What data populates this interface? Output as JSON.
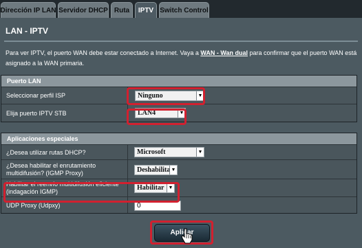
{
  "tabs": [
    {
      "label": "Dirección IP LAN",
      "active": false
    },
    {
      "label": "Servidor DHCP",
      "active": false
    },
    {
      "label": "Ruta",
      "active": false
    },
    {
      "label": "IPTV",
      "active": true
    },
    {
      "label": "Switch Control",
      "active": false
    }
  ],
  "page_title": "LAN - IPTV",
  "description": {
    "before": "Para ver IPTV, el puerto WAN debe estar conectado a Internet. Vaya a ",
    "link": "WAN - Wan dual",
    "after": " para confirmar que el puerto WAN está asignado a la WAN primaria."
  },
  "puerto_lan": {
    "header": "Puerto LAN",
    "isp_profile": {
      "label": "Seleccionar perfil ISP",
      "value": "Ninguno"
    },
    "iptv_port": {
      "label": "Elija puerto IPTV STB",
      "value": "LAN4"
    }
  },
  "aplicaciones": {
    "header": "Aplicaciones especiales",
    "dhcp_routes": {
      "label": "¿Desea utilizar rutas DHCP?",
      "value": "Microsoft"
    },
    "multicast_routing": {
      "label_line1": "¿Desea habilitar el enrutamiento",
      "label_line2": "multidifusión? (IGMP Proxy)",
      "value": "Deshabilitar"
    },
    "efficient_multicast": {
      "label_line1": "Habilitar el reenvío multidifusión eficiente",
      "label_line2": "(indagación IGMP)",
      "value": "Habilitar"
    },
    "udp_proxy": {
      "label": "UDP Proxy (Udpxy)",
      "value": "0"
    }
  },
  "apply_button": "Aplicar",
  "colors": {
    "highlight": "#d2202f",
    "panel": "#4c5a61",
    "header": "#8c979d"
  }
}
